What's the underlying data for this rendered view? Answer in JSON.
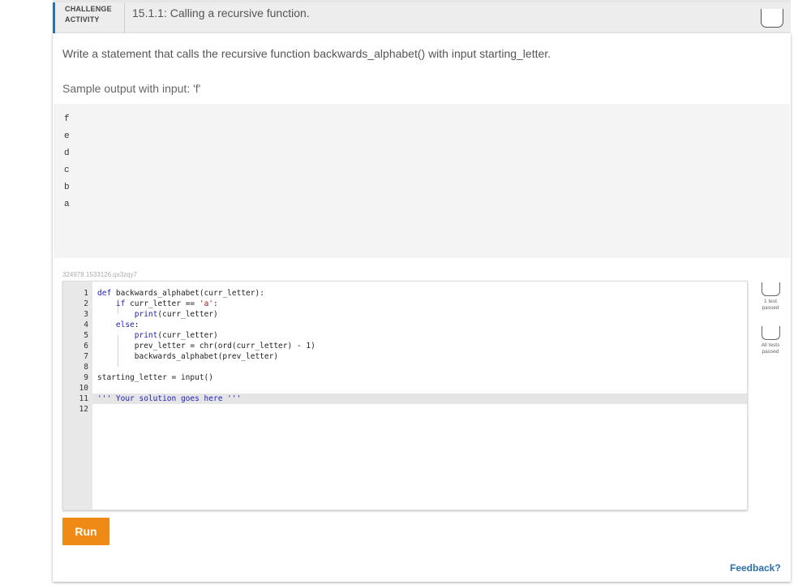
{
  "header": {
    "activity_type_line1": "CHALLENGE",
    "activity_type_line2": "ACTIVITY",
    "title": "15.1.1: Calling a recursive function."
  },
  "instructions": "Write a statement that calls the recursive function backwards_alphabet() with input starting_letter.",
  "sample": {
    "label": "Sample output with input: 'f'",
    "lines": [
      "f",
      "e",
      "d",
      "c",
      "b",
      "a"
    ]
  },
  "activity_id": "324978.1533126.qx3zqy7",
  "editor": {
    "line_numbers": [
      "1",
      "2",
      "3",
      "4",
      "5",
      "6",
      "7",
      "8",
      "9",
      "10",
      "11",
      "12"
    ],
    "code": [
      [
        {
          "t": "def ",
          "c": "kw"
        },
        {
          "t": "backwards_alphabet(curr_letter):",
          "c": ""
        }
      ],
      [
        {
          "t": "    ",
          "c": ""
        },
        {
          "t": "if ",
          "c": "kw"
        },
        {
          "t": "curr_letter == ",
          "c": ""
        },
        {
          "t": "'a'",
          "c": "str"
        },
        {
          "t": ":",
          "c": ""
        }
      ],
      [
        {
          "t": "        ",
          "c": ""
        },
        {
          "t": "print",
          "c": "kw"
        },
        {
          "t": "(curr_letter)",
          "c": ""
        }
      ],
      [
        {
          "t": "    ",
          "c": ""
        },
        {
          "t": "else",
          "c": "kw"
        },
        {
          "t": ":",
          "c": ""
        }
      ],
      [
        {
          "t": "        ",
          "c": ""
        },
        {
          "t": "print",
          "c": "kw"
        },
        {
          "t": "(curr_letter)",
          "c": ""
        }
      ],
      [
        {
          "t": "        prev_letter = chr(ord(curr_letter) - ",
          "c": ""
        },
        {
          "t": "1",
          "c": ""
        },
        {
          "t": ")",
          "c": ""
        }
      ],
      [
        {
          "t": "        backwards_alphabet(prev_letter)",
          "c": ""
        }
      ],
      [],
      [
        {
          "t": "starting_letter = input()",
          "c": ""
        }
      ],
      [],
      [
        {
          "t": "''' Your solution goes here '''",
          "c": "cmt"
        }
      ],
      []
    ]
  },
  "run_label": "Run",
  "tests": [
    {
      "line1": "1 test",
      "line2": "passed"
    },
    {
      "line1": "All tests",
      "line2": "passed"
    }
  ],
  "feedback_label": "Feedback?"
}
